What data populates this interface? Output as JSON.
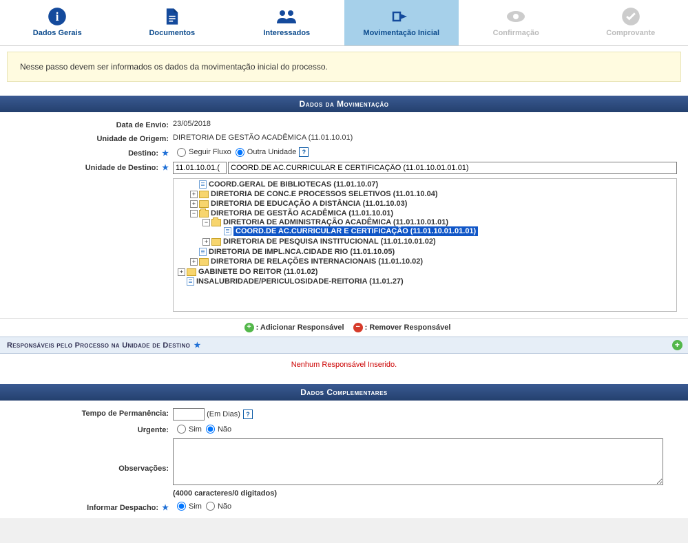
{
  "steps": [
    {
      "label": "Dados Gerais",
      "state": "done"
    },
    {
      "label": "Documentos",
      "state": "done"
    },
    {
      "label": "Interessados",
      "state": "done"
    },
    {
      "label": "Movimentação Inicial",
      "state": "active"
    },
    {
      "label": "Confirmação",
      "state": "disabled"
    },
    {
      "label": "Comprovante",
      "state": "disabled"
    }
  ],
  "info_text": "Nesse passo devem ser informados os dados da movimentação inicial do processo.",
  "section_mov_title": "Dados da Movimentação",
  "fields": {
    "data_envio_label": "Data de Envio:",
    "data_envio_value": "23/05/2018",
    "unidade_origem_label": "Unidade de Origem:",
    "unidade_origem_value": "DIRETORIA DE GESTÃO ACADÊMICA (11.01.10.01)",
    "destino_label": "Destino:",
    "destino_opt1": "Seguir Fluxo",
    "destino_opt2": "Outra Unidade",
    "unidade_destino_label": "Unidade de Destino:",
    "unidade_destino_code": "11.01.10.01.(",
    "unidade_destino_name": "COORD.DE AC.CURRICULAR E CERTIFICAÇÃO (11.01.10.01.01.01)"
  },
  "tree": {
    "n0": "COORD.GERAL DE BIBLIOTECAS (11.01.10.07)",
    "n1": "DIRETORIA DE CONC.E PROCESSOS SELETIVOS (11.01.10.04)",
    "n2": "DIRETORIA DE EDUCAÇÃO A DISTÂNCIA (11.01.10.03)",
    "n3": "DIRETORIA DE GESTÃO ACADÊMICA (11.01.10.01)",
    "n3a": "DIRETORIA DE ADMINISTRAÇÃO ACADÊMICA (11.01.10.01.01)",
    "n3a1": "COORD.DE AC.CURRICULAR E CERTIFICAÇÃO (11.01.10.01.01.01)",
    "n3b": "DIRETORIA DE PESQUISA INSTITUCIONAL (11.01.10.01.02)",
    "n4": "DIRETORIA DE IMPL.NCA.CIDADE RIO (11.01.10.05)",
    "n5": "DIRETORIA DE RELAÇÕES INTERNACIONAIS (11.01.10.02)",
    "n6": "GABINETE DO REITOR (11.01.02)",
    "n7": "INSALUBRIDADE/PERICULOSIDADE-REITORIA (11.01.27)"
  },
  "legend": {
    "add": ": Adicionar Responsável",
    "remove": ": Remover Responsável"
  },
  "responsaveis_header": "Responsáveis pelo Processo na Unidade de Destino",
  "responsaveis_empty": "Nenhum Responsável Inserido.",
  "section_comp_title": "Dados Complementares",
  "comp": {
    "tempo_label": "Tempo de Permanência:",
    "tempo_unit": "(Em Dias)",
    "urgente_label": "Urgente:",
    "sim": "Sim",
    "nao": "Não",
    "obs_label": "Observações:",
    "char_count": "(4000 caracteres/0 digitados)",
    "despacho_label": "Informar Despacho:"
  }
}
